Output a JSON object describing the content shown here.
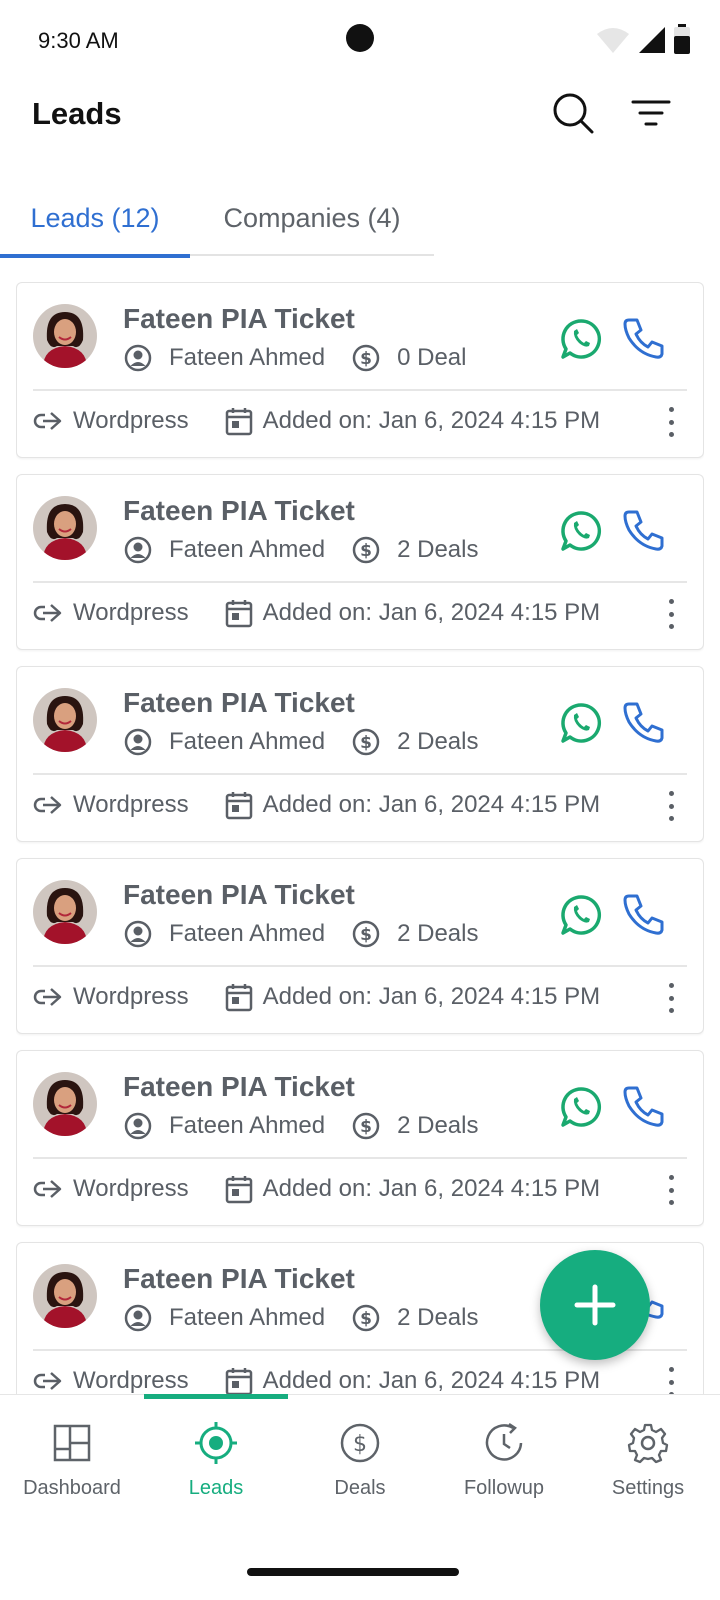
{
  "status_bar": {
    "time": "9:30 AM"
  },
  "app_bar": {
    "title": "Leads"
  },
  "tabs": [
    {
      "label": "Leads (12)"
    },
    {
      "label": "Companies (4)"
    }
  ],
  "leads": [
    {
      "title": "Fateen PIA Ticket",
      "owner": "Fateen Ahmed",
      "deals": "0 Deal",
      "source": "Wordpress",
      "added": "Added on: Jan 6, 2024 4:15 PM"
    },
    {
      "title": "Fateen PIA Ticket",
      "owner": "Fateen Ahmed",
      "deals": "2 Deals",
      "source": "Wordpress",
      "added": "Added on: Jan 6, 2024 4:15 PM"
    },
    {
      "title": "Fateen PIA Ticket",
      "owner": "Fateen Ahmed",
      "deals": "2 Deals",
      "source": "Wordpress",
      "added": "Added on: Jan 6, 2024 4:15 PM"
    },
    {
      "title": "Fateen PIA Ticket",
      "owner": "Fateen Ahmed",
      "deals": "2 Deals",
      "source": "Wordpress",
      "added": "Added on: Jan 6, 2024 4:15 PM"
    },
    {
      "title": "Fateen PIA Ticket",
      "owner": "Fateen Ahmed",
      "deals": "2 Deals",
      "source": "Wordpress",
      "added": "Added on: Jan 6, 2024 4:15 PM"
    },
    {
      "title": "Fateen PIA Ticket",
      "owner": "Fateen Ahmed",
      "deals": "2 Deals",
      "source": "Wordpress",
      "added": "Added on: Jan 6, 2024 4:15 PM"
    }
  ],
  "bottom_nav": [
    {
      "label": "Dashboard",
      "icon": "dashboard-icon"
    },
    {
      "label": "Leads",
      "icon": "target-icon",
      "active": true
    },
    {
      "label": "Deals",
      "icon": "dollar-icon"
    },
    {
      "label": "Followup",
      "icon": "clock-icon"
    },
    {
      "label": "Settings",
      "icon": "gear-icon"
    }
  ],
  "colors": {
    "primary_blue": "#2f6fd1",
    "accent_green": "#16ad7f",
    "whatsapp_green": "#1aa96f",
    "text_gray": "#5a5f66"
  }
}
